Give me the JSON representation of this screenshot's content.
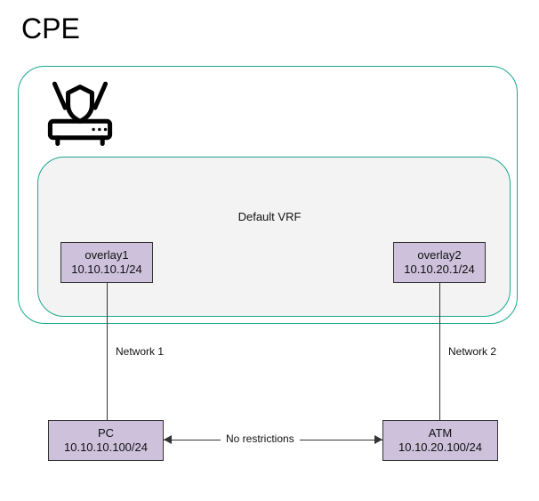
{
  "title": "CPE",
  "vrf_label": "Default VRF",
  "interfaces": {
    "left": {
      "name": "overlay1",
      "cidr": "10.10.10.1/24"
    },
    "right": {
      "name": "overlay2",
      "cidr": "10.10.20.1/24"
    }
  },
  "links": {
    "left": {
      "label": "Network 1"
    },
    "right": {
      "label": "Network 2"
    },
    "bottom": {
      "label": "No restrictions"
    }
  },
  "hosts": {
    "left": {
      "name": "PC",
      "cidr": "10.10.10.100/24"
    },
    "right": {
      "name": "ATM",
      "cidr": "10.10.20.100/24"
    }
  }
}
